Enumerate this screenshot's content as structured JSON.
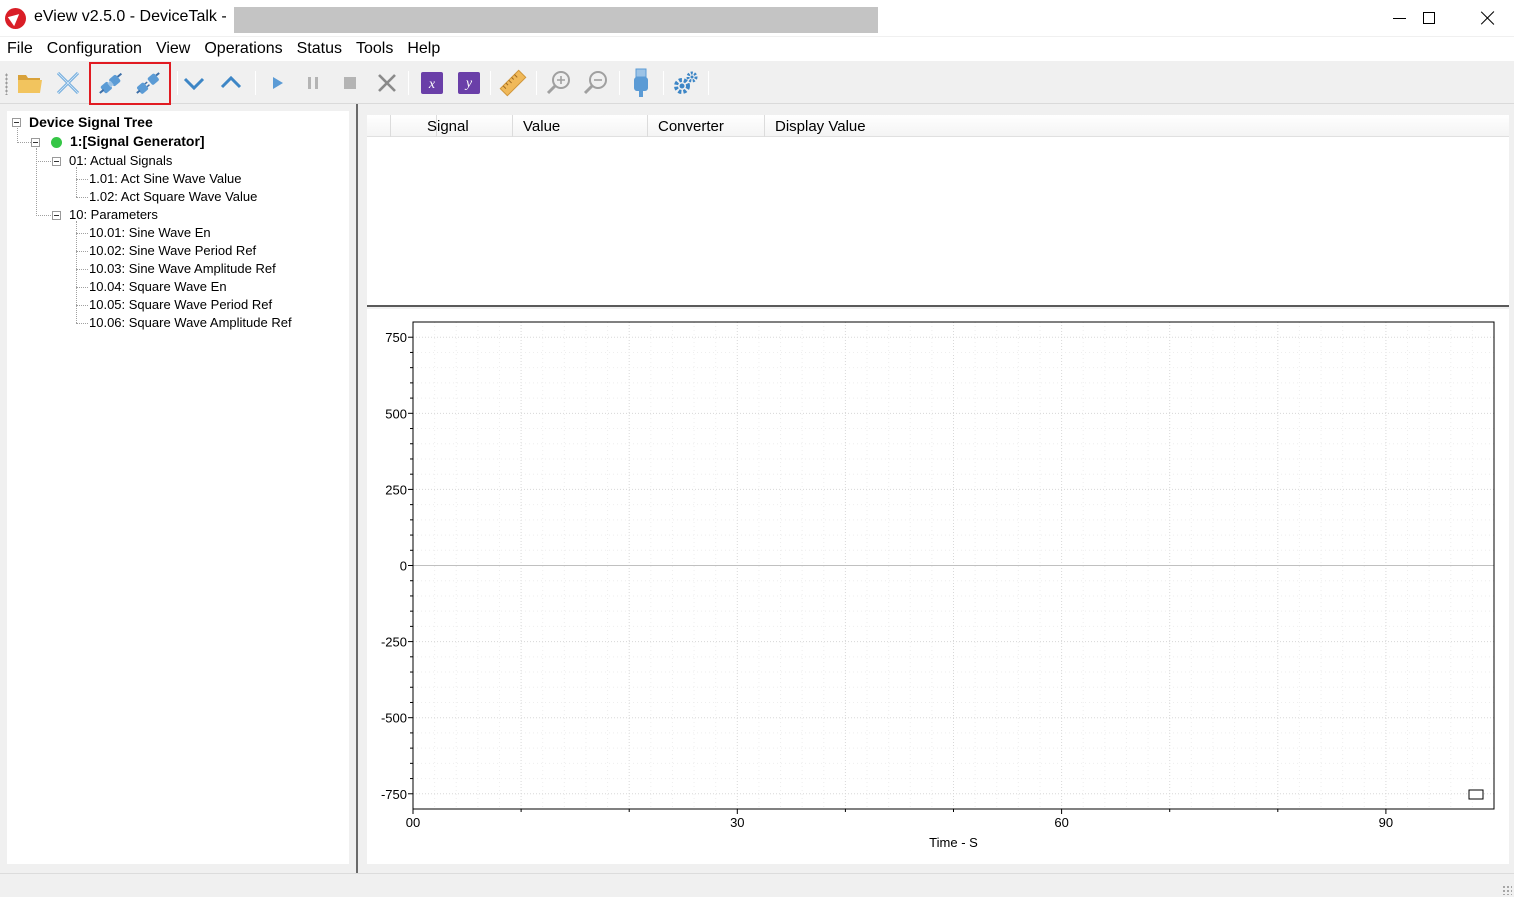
{
  "window": {
    "title": "eView v2.5.0 - DeviceTalk  -",
    "controls": [
      "minimize",
      "maximize",
      "close"
    ]
  },
  "menu": [
    "File",
    "Configuration",
    "View",
    "Operations",
    "Status",
    "Tools",
    "Help"
  ],
  "toolbar": {
    "buttons": [
      {
        "icon": "open-folder-icon"
      },
      {
        "icon": "close-file-icon"
      },
      {
        "icon": "connect-icon",
        "highlighted": true
      },
      {
        "icon": "disconnect-icon",
        "highlighted": true
      },
      {
        "icon": "chevron-down-icon"
      },
      {
        "icon": "chevron-up-icon"
      },
      {
        "icon": "play-icon"
      },
      {
        "icon": "pause-icon"
      },
      {
        "icon": "stop-icon"
      },
      {
        "icon": "clear-icon"
      },
      {
        "icon": "x-axis-icon",
        "label": "x"
      },
      {
        "icon": "y-axis-icon",
        "label": "y"
      },
      {
        "icon": "ruler-icon"
      },
      {
        "icon": "zoom-in-icon"
      },
      {
        "icon": "zoom-out-icon"
      },
      {
        "icon": "usb-icon"
      },
      {
        "icon": "settings-gears-icon"
      }
    ],
    "colors": {
      "highlight": "#e11b22",
      "accent": "#3d86c6",
      "purple": "#6a3fa8"
    }
  },
  "tree": {
    "root": "Device Signal Tree",
    "device": {
      "label": "1:[Signal Generator]",
      "status_color": "#35c646"
    },
    "groups": [
      {
        "label": "01: Actual Signals",
        "items": [
          "1.01: Act Sine Wave Value",
          "1.02: Act Square Wave Value"
        ]
      },
      {
        "label": "10: Parameters",
        "items": [
          "10.01: Sine Wave En",
          "10.02: Sine Wave Period Ref",
          "10.03: Sine Wave Amplitude Ref",
          "10.04: Square Wave En",
          "10.05: Square Wave Period Ref",
          "10.06: Square Wave Amplitude Ref"
        ]
      }
    ]
  },
  "table": {
    "columns": [
      "Signal",
      "Value",
      "Converter",
      "Display Value"
    ],
    "rows": []
  },
  "chart_data": {
    "type": "line",
    "series": [],
    "xlabel": "Time - S",
    "ylabel": "",
    "xlim": [
      0,
      100
    ],
    "ylim": [
      -800,
      800
    ],
    "x_ticks": [
      {
        "value": 0,
        "label": "00"
      },
      {
        "value": 30,
        "label": "30"
      },
      {
        "value": 60,
        "label": "60"
      },
      {
        "value": 90,
        "label": "90"
      }
    ],
    "y_ticks": [
      750,
      500,
      250,
      0,
      -250,
      -500,
      -750
    ],
    "grid": true,
    "legend": "bottom-right",
    "zero_line": true
  }
}
